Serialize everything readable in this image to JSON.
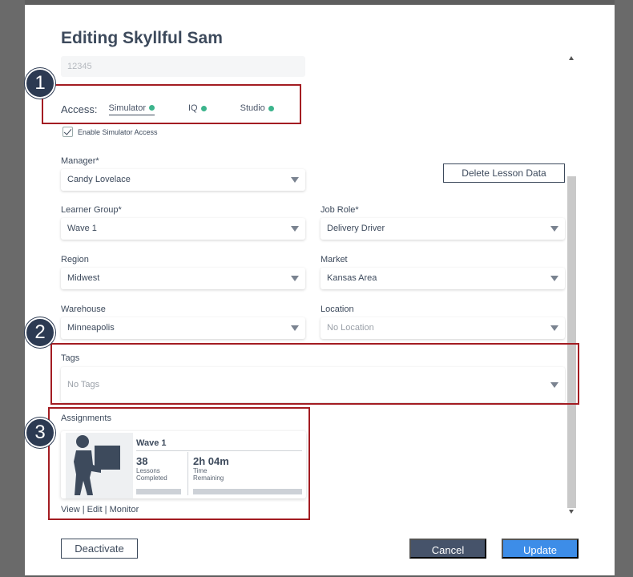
{
  "modal": {
    "title": "Editing Skyllful Sam",
    "employee_id": "12345"
  },
  "access": {
    "label": "Access:",
    "tabs": [
      {
        "label": "Simulator",
        "active": true
      },
      {
        "label": "IQ",
        "active": false
      },
      {
        "label": "Studio",
        "active": false
      }
    ],
    "status_color": "#3cb48c",
    "enable_simulator_label": "Enable Simulator Access",
    "enable_simulator_checked": true
  },
  "fields": {
    "manager": {
      "label": "Manager*",
      "value": "Candy Lovelace"
    },
    "learner_group": {
      "label": "Learner Group*",
      "value": "Wave 1"
    },
    "job_role": {
      "label": "Job Role*",
      "value": "Delivery Driver"
    },
    "region": {
      "label": "Region",
      "value": "Midwest"
    },
    "market": {
      "label": "Market",
      "value": "Kansas Area"
    },
    "warehouse": {
      "label": "Warehouse",
      "value": "Minneapolis"
    },
    "location": {
      "label": "Location",
      "placeholder": "No Location"
    },
    "tags": {
      "label": "Tags",
      "placeholder": "No Tags"
    }
  },
  "delete_lesson_label": "Delete Lesson Data",
  "assignments": {
    "label": "Assignments",
    "card": {
      "icon": "person-carrying-box-icon",
      "title": "Wave 1",
      "lessons_completed": "38",
      "lessons_completed_label_1": "Lessons",
      "lessons_completed_label_2": "Completed",
      "time_remaining": "2h 04m",
      "time_remaining_label_1": "Time",
      "time_remaining_label_2": "Remaining"
    },
    "links": {
      "view": "View",
      "sep1": " | ",
      "edit": "Edit",
      "sep2": " | ",
      "monitor": "Monitor"
    }
  },
  "buttons": {
    "deactivate": "Deactivate",
    "cancel": "Cancel",
    "update": "Update"
  },
  "callouts": [
    "1",
    "2",
    "3"
  ],
  "colors": {
    "callout_border": "#a31c22",
    "callout_badge": "#2c3a52",
    "primary": "#3d8de8",
    "secondary": "#46536a"
  }
}
